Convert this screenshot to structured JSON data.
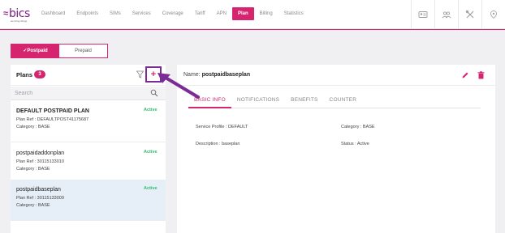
{
  "brand": {
    "name": "bics",
    "tagline": "we bring things"
  },
  "nav": {
    "items": [
      "Dashboard",
      "Endpoints",
      "SIMs",
      "Services",
      "Coverage",
      "Tariff",
      "APN",
      "Plan",
      "Billing",
      "Statistics"
    ],
    "active_index": 7
  },
  "top_icons": [
    "card-icon",
    "users-icon",
    "tools-icon",
    "location-icon"
  ],
  "toggle": {
    "postpaid": "✓Postpaid",
    "prepaid": "Prepaid"
  },
  "plans": {
    "title": "Plans",
    "count": "3",
    "add_symbol": "+",
    "search_placeholder": "Search",
    "items": [
      {
        "name": "DEFAULT POSTPAID PLAN",
        "status": "Active",
        "ref": "Plan Ref : DEFAULTPOST41175687",
        "category": "Category : BASE"
      },
      {
        "name": "postpaidaddonplan",
        "status": "Active",
        "ref": "Plan Ref : 30115133010",
        "category": "Category : BASE"
      },
      {
        "name": "postpaidbaseplan",
        "status": "Active",
        "ref": "Plan Ref : 30115133009",
        "category": "Category : BASE"
      }
    ]
  },
  "detail": {
    "name_label": "Name:",
    "name_value": "postpaidbaseplan",
    "tabs": [
      "BASIC INFO",
      "NOTIFICATIONS",
      "BENEFITS",
      "COUNTER"
    ],
    "active_tab": 0,
    "service_profile": "Service Profile : DEFAULT",
    "category": "Category : BASE",
    "description": "Description : baseplan",
    "status": "Status : Active"
  },
  "colors": {
    "accent": "#d5256f",
    "brand": "#7a1f86",
    "active_green": "#2bbf6c",
    "annotation": "#7b2a96"
  }
}
